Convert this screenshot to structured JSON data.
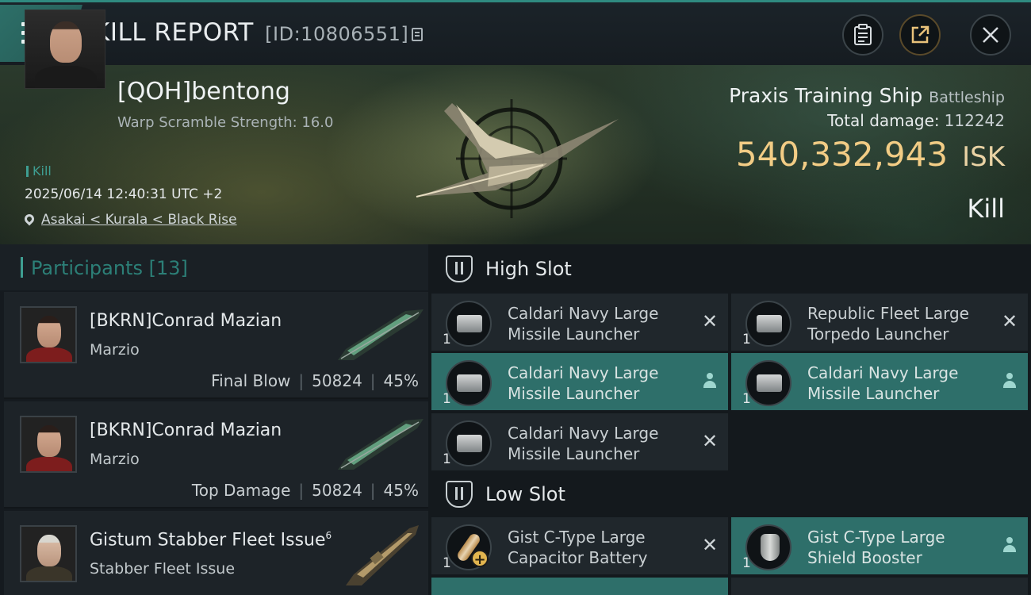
{
  "header": {
    "title": "KILL REPORT",
    "id_label": "[ID:10806551]"
  },
  "victim": {
    "name": "[QOH]bentong",
    "warp_scramble": "Warp Scramble Strength: 16.0",
    "tag": "Kill",
    "datetime": "2025/06/14 12:40:31 UTC +2",
    "location": "Asakai < Kurala < Black Rise",
    "ship_name": "Praxis Training Ship",
    "ship_class": "Battleship",
    "total_damage_label": "Total damage:",
    "total_damage": "112242",
    "isk_value": "540,332,943",
    "isk_unit": "ISK",
    "result": "Kill"
  },
  "participants": {
    "header": "Participants [13]",
    "rows": [
      {
        "name": "[BKRN]Conrad Mazian",
        "superscript": "",
        "ship": "Marzio",
        "role": "Final Blow",
        "damage": "50824",
        "percent": "45%"
      },
      {
        "name": "[BKRN]Conrad Mazian",
        "superscript": "",
        "ship": "Marzio",
        "role": "Top Damage",
        "damage": "50824",
        "percent": "45%"
      },
      {
        "name": "Gistum Stabber Fleet Issue",
        "superscript": "6",
        "ship": "Stabber Fleet Issue",
        "role": "",
        "damage": "",
        "percent": ""
      }
    ]
  },
  "fitting": {
    "high_slot_label": "High Slot",
    "low_slot_label": "Low Slot",
    "high_slot": [
      {
        "name": "Caldari Navy Large Missile Launcher",
        "qty": "1",
        "state": "destroyed",
        "icon": "missile-launcher-icon"
      },
      {
        "name": "Republic Fleet Large Torpedo Launcher",
        "qty": "1",
        "state": "destroyed",
        "icon": "torpedo-launcher-icon"
      },
      {
        "name": "Caldari Navy Large Missile Launcher",
        "qty": "1",
        "state": "dropped",
        "icon": "missile-launcher-icon"
      },
      {
        "name": "Caldari Navy Large Missile Launcher",
        "qty": "1",
        "state": "dropped",
        "icon": "missile-launcher-icon"
      },
      {
        "name": "Caldari Navy Large Missile Launcher",
        "qty": "1",
        "state": "destroyed",
        "icon": "missile-launcher-icon"
      }
    ],
    "low_slot": [
      {
        "name": "Gist C-Type Large Capacitor Battery",
        "qty": "1",
        "state": "destroyed",
        "icon": "capacitor-battery-icon"
      },
      {
        "name": "Gist C-Type Large Shield Booster",
        "qty": "1",
        "state": "dropped",
        "icon": "shield-booster-icon"
      }
    ]
  },
  "colors": {
    "accent": "#2f8a80",
    "isk": "#f2cc85",
    "dropped_bg": "#2e6f6a",
    "destroyed_bg": "#20272c"
  }
}
